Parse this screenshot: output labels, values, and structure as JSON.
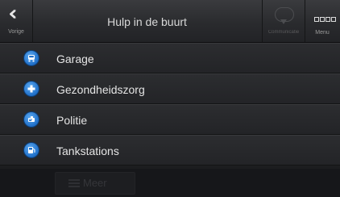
{
  "topbar": {
    "back_label": "Vorige",
    "title": "Hulp in de buurt",
    "comm_label": "Communicatie",
    "menu_label": "Menu"
  },
  "categories": [
    {
      "label": "Garage",
      "icon": "car-service-icon"
    },
    {
      "label": "Gezondheidszorg",
      "icon": "health-cross-icon"
    },
    {
      "label": "Politie",
      "icon": "police-icon"
    },
    {
      "label": "Tankstations",
      "icon": "fuel-pump-icon"
    }
  ],
  "bottom": {
    "more_label": "Meer"
  },
  "colors": {
    "accent_blue": "#1f6fc8",
    "background": "#1c1d1f",
    "text": "#e4e4e4"
  }
}
